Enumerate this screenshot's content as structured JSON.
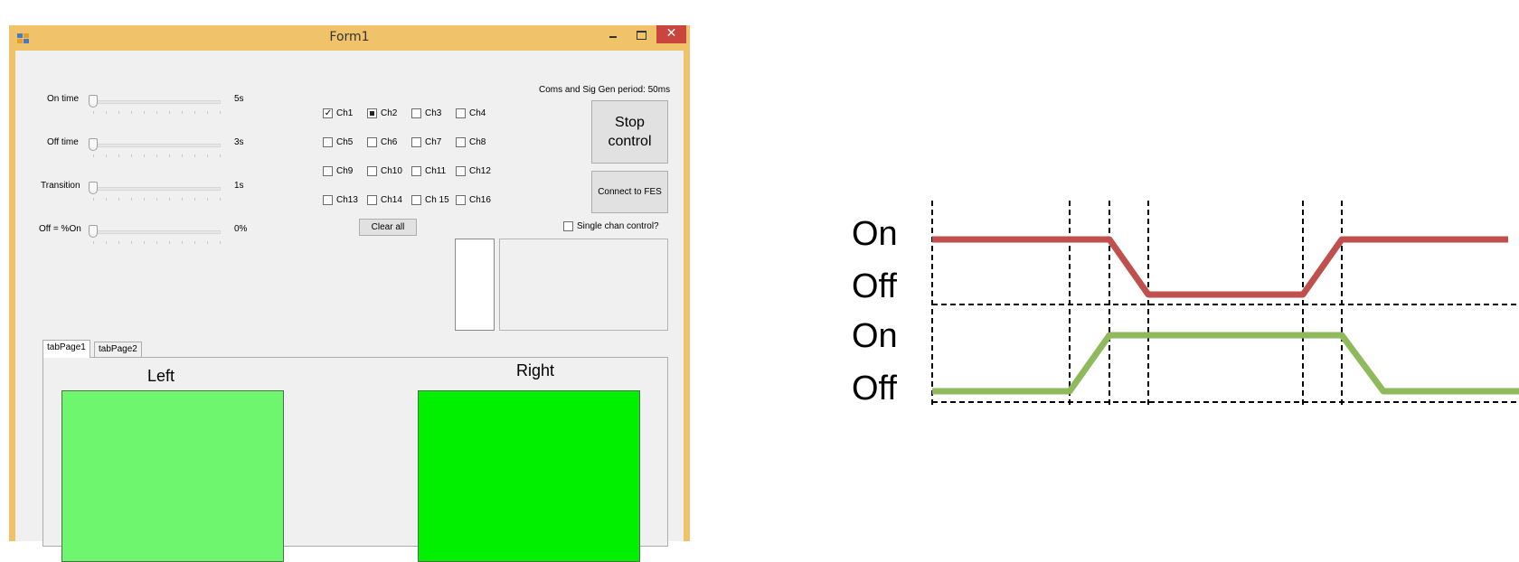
{
  "window": {
    "title": "Form1",
    "close_glyph": "✕",
    "accent": "#f0c36a",
    "close_color": "#c9453d"
  },
  "sliders": [
    {
      "label": "On time",
      "value_text": "5s"
    },
    {
      "label": "Off time",
      "value_text": "3s"
    },
    {
      "label": "Transition",
      "value_text": "1s"
    },
    {
      "label": "Off = %On",
      "value_text": "0%"
    }
  ],
  "status_text": "Coms and Sig Gen period: 50ms",
  "channels": [
    {
      "label": "Ch1",
      "state": "checked"
    },
    {
      "label": "Ch2",
      "state": "indeterminate"
    },
    {
      "label": "Ch3",
      "state": "unchecked"
    },
    {
      "label": "Ch4",
      "state": "unchecked"
    },
    {
      "label": "Ch5",
      "state": "unchecked"
    },
    {
      "label": "Ch6",
      "state": "unchecked"
    },
    {
      "label": "Ch7",
      "state": "unchecked"
    },
    {
      "label": "Ch8",
      "state": "unchecked"
    },
    {
      "label": "Ch9",
      "state": "unchecked"
    },
    {
      "label": "Ch10",
      "state": "unchecked"
    },
    {
      "label": "Ch11",
      "state": "unchecked"
    },
    {
      "label": "Ch12",
      "state": "unchecked"
    },
    {
      "label": "Ch13",
      "state": "unchecked"
    },
    {
      "label": "Ch14",
      "state": "unchecked"
    },
    {
      "label": "Ch 15",
      "state": "unchecked"
    },
    {
      "label": "Ch16",
      "state": "unchecked"
    }
  ],
  "buttons": {
    "stop_control_line1": "Stop",
    "stop_control_line2": "control",
    "connect": "Connect to FES",
    "clear_all": "Clear all"
  },
  "single_chan": {
    "label": "Single chan control?",
    "checked": false
  },
  "tabs": [
    "tabPage1",
    "tabPage2"
  ],
  "tab_content": {
    "left_heading": "Left",
    "right_heading": "Right",
    "left_color": "#6ef66e",
    "right_color": "#00f000"
  },
  "diagram": {
    "labels": [
      "On",
      "Off",
      "On",
      "Off"
    ],
    "top_trace_color": "#c0504d",
    "bottom_trace_color": "#8fba5b"
  }
}
